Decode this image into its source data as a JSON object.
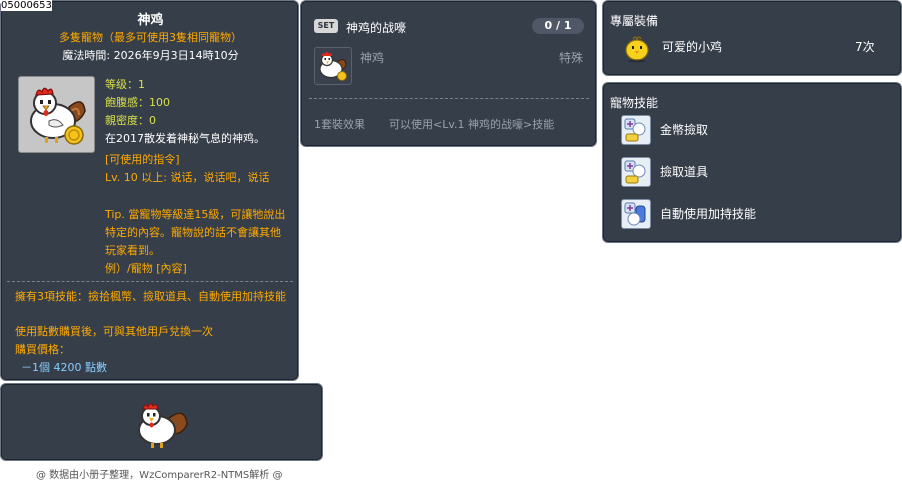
{
  "item_id": "05000653",
  "main": {
    "title": "神鸡",
    "subtitle": "多隻寵物（最多可使用3隻相同寵物）",
    "magic_time": "魔法時間:  2026年9月3日14時10分",
    "stats": {
      "level": "等级：1",
      "fullness": "飽腹感：100",
      "closeness": "親密度：0"
    },
    "description": "在2017散发着神秘气息的神鸡。",
    "commands_header": "[可使用的指令]",
    "command_line": "Lv. 10 以上:  说话，说话吧，说话",
    "tip": "Tip. 當寵物等級達15級，可讓牠說出特定的內容。寵物說的話不會讓其他玩家看到。",
    "example": "例）/寵物 [內容]",
    "skills_line": "擁有3項技能：撿拾楓幣、撿取道具、自動使用加持技能",
    "exchange_line": "使用點數購買後，可與其他用戶兌換一次",
    "price_label": "購買價格：",
    "price_value": "－1個  4200 點數"
  },
  "credit": "@ 数据由小册子整理，WzComparerR2-NTMS解析 @",
  "set": {
    "badge": "SET",
    "name": "神鸡的战嚎",
    "count": "0 / 1",
    "item_name": "神鸡",
    "item_type": "特殊",
    "effect_label": "1套裝效果",
    "effect_desc": "可以使用<Lv.1 神鸡的战嚎>技能"
  },
  "exclusive": {
    "title": "專屬裝備",
    "item_name": "可爱的小鸡",
    "count": "7次"
  },
  "skills": {
    "title": "寵物技能",
    "items": [
      {
        "label": "金幣撿取",
        "icon": "coin-pickup-icon"
      },
      {
        "label": "撿取道具",
        "icon": "item-pickup-icon"
      },
      {
        "label": "自動使用加持技能",
        "icon": "auto-buff-icon"
      }
    ]
  },
  "colors": {
    "panel_bg": "#2e3642",
    "orange": "#ffaa00",
    "stat_yellow": "#d8e04a",
    "price_blue": "#88ccff"
  }
}
